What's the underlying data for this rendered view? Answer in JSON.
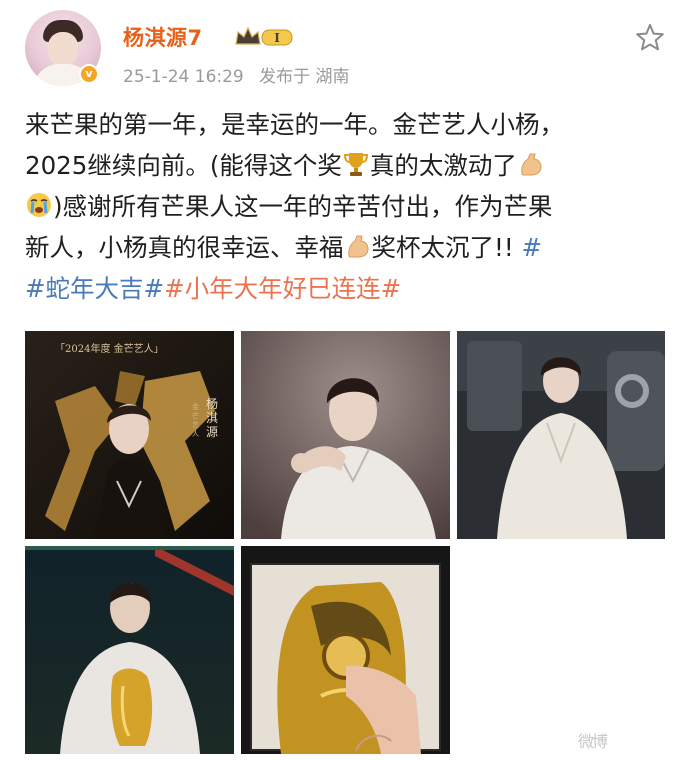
{
  "post": {
    "username": "杨淇源7",
    "vip_level": "I",
    "verified_badge": "v",
    "date": "25-1-24 16:29",
    "location": "发布于 湖南",
    "text_1": "来芒果的第一年，是幸运的一年。金芒艺人小杨，",
    "text_2": "2025继续向前。(能得这个奖",
    "text_3": "真的太激动了",
    "text_4": ")感谢所有芒果人这一年的辛苦付出，作为芒果",
    "text_5": "新人，小杨真的很幸运、幸福",
    "text_6": "奖杯太沉了!!",
    "hashtag_1": "#蛇年大吉#",
    "hashtag_2": "#小年大年好巳连连#"
  },
  "gallery": {
    "image_1_banner": "「2024年度  金芒艺人」",
    "image_1_name": "杨淇源",
    "image_1_small": "金芒艺人"
  },
  "watermark": "微博"
}
